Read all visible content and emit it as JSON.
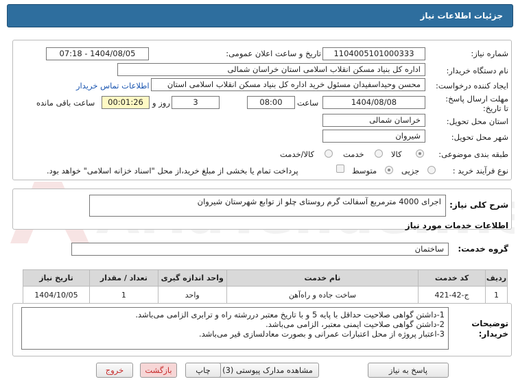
{
  "header": {
    "title": "جزئیات اطلاعات نیاز"
  },
  "watermark": {
    "text": "AriaTender.net"
  },
  "form": {
    "need_number_label": "شماره نیاز:",
    "need_number_value": "1104005101000333",
    "announce_label": "تاریخ و ساعت اعلان عمومی:",
    "announce_value": "1404/08/05 - 07:18",
    "buyer_org_label": "نام دستگاه خریدار:",
    "buyer_org_value": "اداره کل بنیاد مسکن انقلاب اسلامی استان خراسان شمالی",
    "requester_label": "ایجاد کننده درخواست:",
    "requester_value": "محسن وحیداسفیدان مسئول خرید اداره کل بنیاد مسکن انقلاب اسلامی استان",
    "contact_link": "اطلاعات تماس خریدار",
    "deadline_label": "مهلت ارسال پاسخ: تا تاریخ:",
    "deadline_date": "1404/08/08",
    "time_label": "ساعت",
    "deadline_time": "08:00",
    "days_value": "3",
    "days_label": "روز و",
    "remaining_value": "00:01:26",
    "remaining_label": "ساعت باقی مانده",
    "province_label": "استان محل تحویل:",
    "province_value": "خراسان شمالی",
    "city_label": "شهر محل تحویل:",
    "city_value": "شیروان",
    "category_label": "طبقه بندی موضوعی:",
    "category_options": [
      "کالا",
      "خدمت",
      "کالا/خدمت"
    ],
    "category_selected": "کالا",
    "process_label": "نوع فرآیند خرید :",
    "process_options": [
      "جزیی",
      "متوسط"
    ],
    "process_selected": "جزیی",
    "payment_note": "پرداخت تمام یا بخشی از مبلغ خرید،از محل \"اسناد خزانه اسلامی\" خواهد بود."
  },
  "description": {
    "label": "شرح کلی نیاز:",
    "value": "اجرای 4000 مترمربع آسفالت گرم روستای چلو از توابع شهرستان شیروان"
  },
  "services": {
    "section_title": "اطلاعات خدمات مورد نیاز",
    "group_label": "گروه خدمت:",
    "group_value": "ساختمان",
    "columns": [
      "ردیف",
      "کد خدمت",
      "نام خدمت",
      "واحد اندازه گیری",
      "تعداد / مقدار",
      "تاریخ نیاز"
    ],
    "rows": [
      {
        "row": "1",
        "code": "ج-42-421",
        "name": "ساخت جاده و راه‌آهن",
        "unit": "واحد",
        "qty": "1",
        "date": "1404/10/05"
      }
    ]
  },
  "buyer_notes": {
    "label": "توضیحات خریدار:",
    "value": "1-داشتن گواهی صلاحیت حداقل با پایه 5 و با تاریخ معتبر دررشته راه و ترابری الزامی می‌باشد.\n2-داشتن گواهی صلاحیت ایمنی معتبر، الزامی می‌باشد.\n3-اعتبار پروژه از محل اعتبارات عمرانی و بصورت معادلسازی قیر می‌باشد."
  },
  "buttons": {
    "reply": "پاسخ به نیاز",
    "attachments": "مشاهده مدارک پیوستی (3)",
    "print": "چاپ",
    "back": "بازگشت",
    "exit": "خروج"
  }
}
